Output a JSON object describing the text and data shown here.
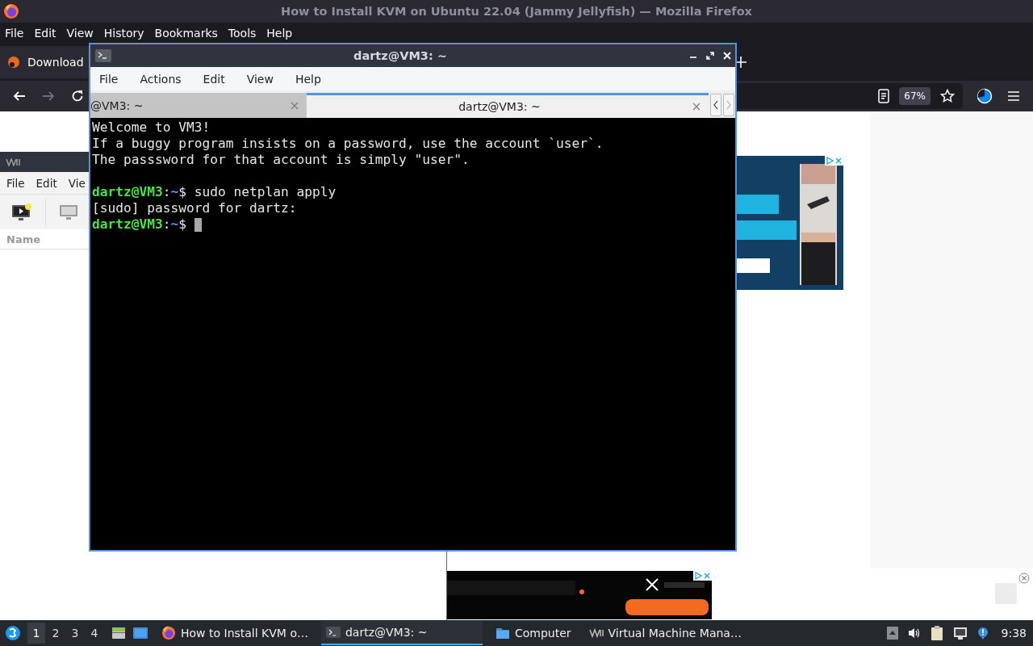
{
  "browser": {
    "title": "How to Install KVM on Ubuntu 22.04 (Jammy Jellyfish) — Mozilla Firefox",
    "menu": [
      "File",
      "Edit",
      "View",
      "History",
      "Bookmarks",
      "Tools",
      "Help"
    ],
    "tabs": [
      {
        "label": "Download",
        "selected": true
      }
    ],
    "nav_buttons": [
      {
        "kind": "back",
        "disabled": false
      },
      {
        "kind": "forward",
        "disabled": true
      },
      {
        "kind": "reload",
        "disabled": false
      }
    ],
    "zoom": "67%"
  },
  "vm_manager": {
    "menu": [
      "File",
      "Edit",
      "Vie"
    ],
    "column": "Name"
  },
  "terminal": {
    "title": "dartz@VM3: ~",
    "menu": [
      "File",
      "Actions",
      "Edit",
      "View",
      "Help"
    ],
    "tabs": [
      {
        "label": "@VM3: ~",
        "selected": false
      },
      {
        "label": "dartz@VM3: ~",
        "selected": true
      }
    ],
    "lines": [
      {
        "kind": "output",
        "text": "Welcome to VM3!"
      },
      {
        "kind": "output",
        "text": "If a buggy program insists on a password, use the account `user`."
      },
      {
        "kind": "output",
        "text": "The passsword for that account is simply \"user\"."
      },
      {
        "kind": "blank"
      },
      {
        "kind": "prompt",
        "host": "dartz@VM3",
        "sep": ":",
        "path": "~",
        "sign": "$",
        "command": "sudo netplan apply"
      },
      {
        "kind": "output",
        "text": "[sudo] password for dartz:"
      },
      {
        "kind": "prompt",
        "host": "dartz@VM3",
        "sep": ":",
        "path": "~",
        "sign": "$",
        "cursor": true
      }
    ]
  },
  "taskbar": {
    "workspaces": [
      {
        "label": "1",
        "selected": true
      },
      {
        "label": "2",
        "selected": false
      },
      {
        "label": "3",
        "selected": false
      },
      {
        "label": "4",
        "selected": false
      }
    ],
    "tasks": [
      {
        "kind": "firefox",
        "label": "How to Install KVM o…",
        "selected": false
      },
      {
        "kind": "terminal",
        "label": "dartz@VM3: ~",
        "selected": true
      },
      {
        "kind": "folder",
        "label": "Computer",
        "selected": false
      },
      {
        "kind": "vmm",
        "label": "Virtual Machine Mana…",
        "selected": false
      }
    ],
    "clock": "9:38"
  }
}
